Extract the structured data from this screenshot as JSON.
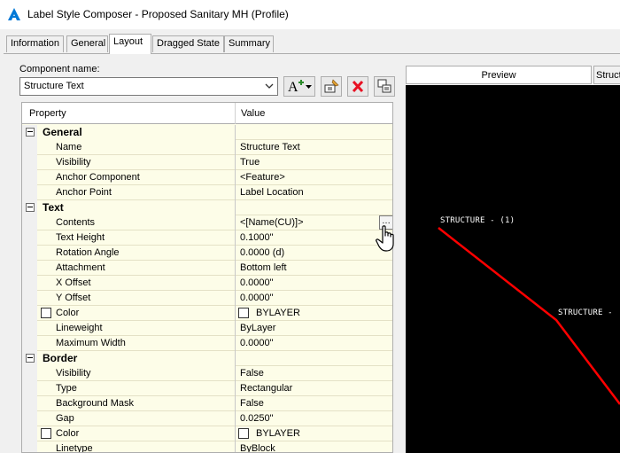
{
  "window": {
    "title": "Label Style Composer - Proposed Sanitary MH (Profile)"
  },
  "tabs": [
    {
      "label": "Information",
      "active": false
    },
    {
      "label": "General",
      "active": false
    },
    {
      "label": "Layout",
      "active": true
    },
    {
      "label": "Dragged State",
      "active": false
    },
    {
      "label": "Summary",
      "active": false
    }
  ],
  "component": {
    "label": "Component name:",
    "selected": "Structure Text"
  },
  "grid": {
    "header": {
      "property": "Property",
      "value": "Value"
    },
    "rows": [
      {
        "kind": "category",
        "property": "General"
      },
      {
        "kind": "item",
        "property": "Name",
        "value": "Structure Text"
      },
      {
        "kind": "item",
        "property": "Visibility",
        "value": "True"
      },
      {
        "kind": "item",
        "property": "Anchor Component",
        "value": "<Feature>"
      },
      {
        "kind": "item",
        "property": "Anchor Point",
        "value": "Label Location"
      },
      {
        "kind": "category",
        "property": "Text"
      },
      {
        "kind": "item",
        "property": "Contents",
        "value": "<[Name(CU)]>",
        "has_ellipsis": true
      },
      {
        "kind": "item",
        "property": "Text Height",
        "value": "0.1000\""
      },
      {
        "kind": "item",
        "property": "Rotation Angle",
        "value": "0.0000 (d)"
      },
      {
        "kind": "item",
        "property": "Attachment",
        "value": "Bottom left"
      },
      {
        "kind": "item",
        "property": "X Offset",
        "value": "0.0000\""
      },
      {
        "kind": "item",
        "property": "Y Offset",
        "value": "0.0000\""
      },
      {
        "kind": "item",
        "property": "Color",
        "value": "BYLAYER",
        "has_checkbox": true,
        "has_swatch": true
      },
      {
        "kind": "item",
        "property": "Lineweight",
        "value": "ByLayer"
      },
      {
        "kind": "item",
        "property": "Maximum Width",
        "value": "0.0000\""
      },
      {
        "kind": "category",
        "property": "Border"
      },
      {
        "kind": "item",
        "property": "Visibility",
        "value": "False"
      },
      {
        "kind": "item",
        "property": "Type",
        "value": "Rectangular"
      },
      {
        "kind": "item",
        "property": "Background Mask",
        "value": "False"
      },
      {
        "kind": "item",
        "property": "Gap",
        "value": "0.0250\""
      },
      {
        "kind": "item",
        "property": "Color",
        "value": "BYLAYER",
        "has_checkbox": true,
        "has_swatch": true
      },
      {
        "kind": "item",
        "property": "Linetype",
        "value": "ByBlock"
      }
    ]
  },
  "preview": {
    "tab_label": "Preview",
    "second_tab_label": "Struct",
    "label1": "STRUCTURE - (1)",
    "label2": "STRUCTURE -"
  },
  "colors": {
    "accent": "#0078d7",
    "grid_background": "#fdfde8",
    "preview_background": "#000000",
    "pipe_line": "#ff0000",
    "delete_icon": "#e81123"
  },
  "icons": [
    "autocad-app-icon",
    "add-component-icon",
    "edit-component-icon",
    "delete-component-icon",
    "copy-component-icon",
    "ellipsis-icon",
    "hand-cursor-icon"
  ]
}
